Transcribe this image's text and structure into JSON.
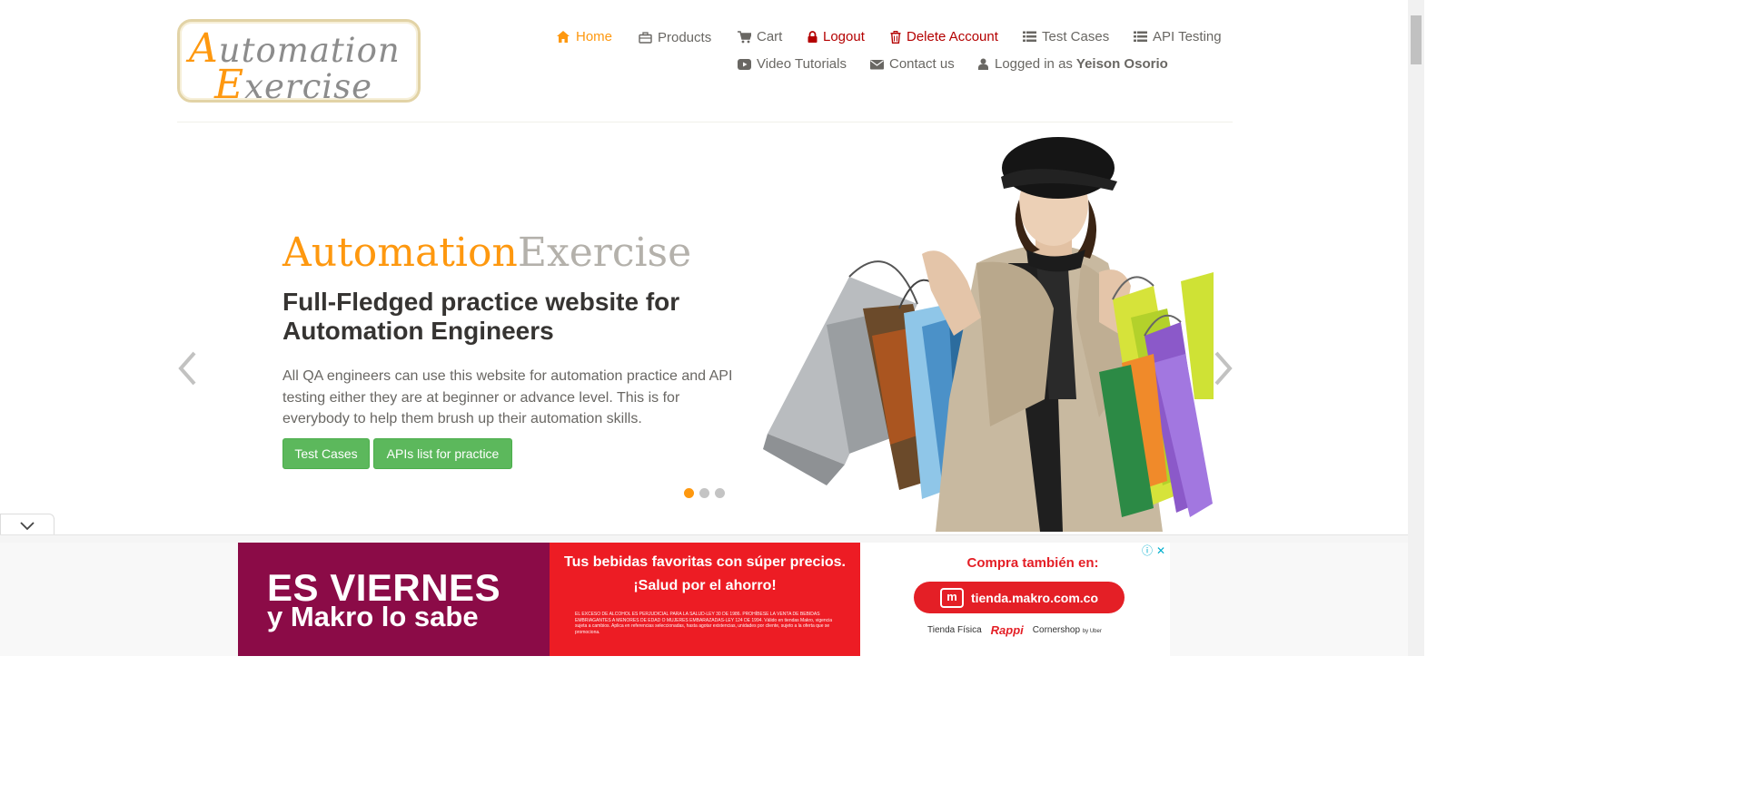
{
  "logo": {
    "line1_cap": "A",
    "line1_rest": "utomation",
    "line2_cap": "E",
    "line2_rest": "xercise"
  },
  "nav": {
    "home": "Home",
    "products": "Products",
    "cart": "Cart",
    "logout": "Logout",
    "delete_account": "Delete Account",
    "test_cases": "Test Cases",
    "api_testing": "API Testing",
    "video_tutorials": "Video Tutorials",
    "contact_us": "Contact us",
    "logged_in_prefix": "Logged in as",
    "logged_in_user": "Yeison Osorio"
  },
  "slider": {
    "brand_part1": "Automation",
    "brand_part2": "Exercise",
    "headline": "Full-Fledged practice website for Automation Engineers",
    "description": "All QA engineers can use this website for automation practice and API testing either they are at beginner or advance level. This is for everybody to help them brush up their automation skills.",
    "btn_test_cases": "Test Cases",
    "btn_apis": "APIs list for practice",
    "active_slide": 1,
    "slide_count": 3
  },
  "ad": {
    "left_line1": "ES VIERNES",
    "left_line2": "y Makro lo sabe",
    "mid_line1": "Tus bebidas favoritas con súper precios.",
    "mid_line2": "¡Salud por el ahorro!",
    "mid_fine": "EL EXCESO DE ALCOHOL ES PERJUDICIAL PARA LA SALUD-LEY 30 DE 1986. PROHÍBESE LA VENTA DE BEBIDAS EMBRIAGANTES A MENORES DE EDAD O MUJERES EMBARAZADAS-LEY 124 DE 1994. Válido en tiendas Makro, vigencia sujeta a cambios. Aplica en referencias seleccionadas, hasta agotar existencias, unidades por cliente, sujeto a la oferta que se promociona.",
    "right_title": "Compra también en:",
    "right_url": "tienda.makro.com.co",
    "store1": "Tienda Física",
    "store2": "Rappi",
    "store3": "Cornershop",
    "store3_sub": "by Uber",
    "info_icon": "ⓘ",
    "close_icon": "✕"
  },
  "colors": {
    "accent": "#fe980f",
    "danger": "#b40000",
    "button": "#5cb85c"
  }
}
